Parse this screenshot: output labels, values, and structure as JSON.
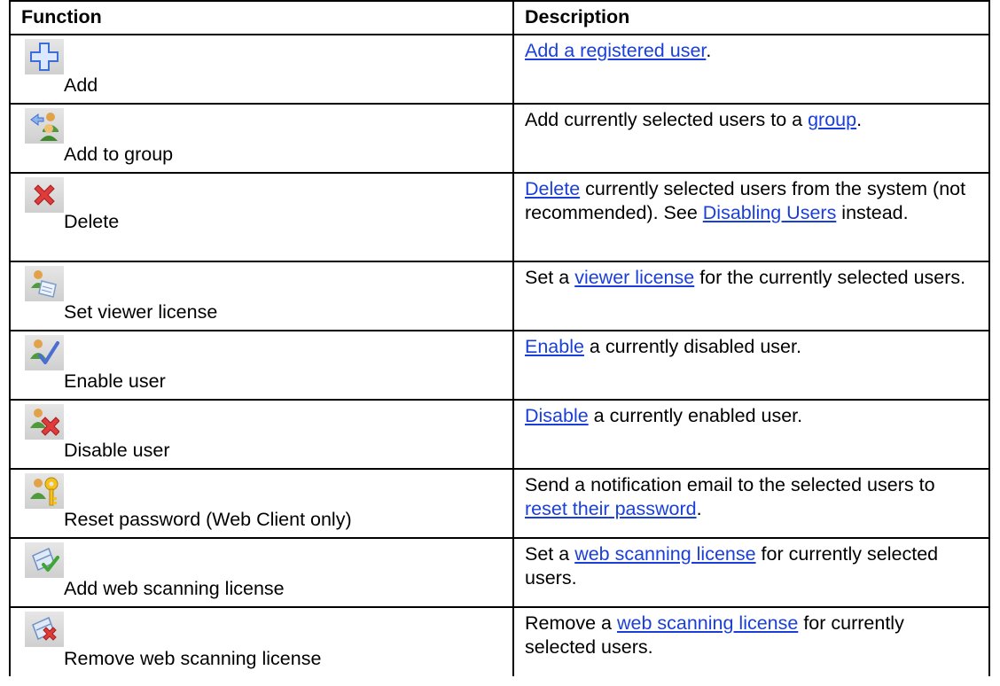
{
  "header": {
    "function": "Function",
    "description": "Description"
  },
  "rows": [
    {
      "icon": "add-icon",
      "function": "Add",
      "description": {
        "pre": "",
        "link": "Add a registered user",
        "post": "."
      }
    },
    {
      "icon": "add-to-group-icon",
      "function": "Add to group",
      "description": {
        "pre": "Add currently selected users to a ",
        "link": "group",
        "post": "."
      }
    },
    {
      "icon": "delete-icon",
      "function": "Delete",
      "description": {
        "pre": "",
        "link": "Delete",
        "mid": " currently selected users from the system (not recommended). See ",
        "link2": "Disabling Users",
        "post": " instead."
      }
    },
    {
      "icon": "viewer-license-icon",
      "function": "Set viewer license",
      "description": {
        "pre": "Set a ",
        "link": "viewer license",
        "post": " for the currently selected users."
      }
    },
    {
      "icon": "enable-user-icon",
      "function": "Enable user",
      "description": {
        "pre": "",
        "link": "Enable",
        "post": " a currently disabled user."
      }
    },
    {
      "icon": "disable-user-icon",
      "function": "Disable user",
      "description": {
        "pre": "",
        "link": "Disable",
        "post": " a currently enabled user."
      }
    },
    {
      "icon": "reset-password-icon",
      "function": "Reset password (Web Client only)",
      "description": {
        "pre": "Send a notification email to the selected users to ",
        "link": "reset their password",
        "post": "."
      }
    },
    {
      "icon": "add-web-scanning-icon",
      "function": "Add web scanning license",
      "description": {
        "pre": "Set a ",
        "link": "web scanning license",
        "post": " for currently selected users."
      }
    },
    {
      "icon": "remove-web-scanning-icon",
      "function": "Remove web scanning license",
      "description": {
        "pre": "Remove a ",
        "link": "web scanning license",
        "post": " for currently selected users."
      }
    }
  ]
}
